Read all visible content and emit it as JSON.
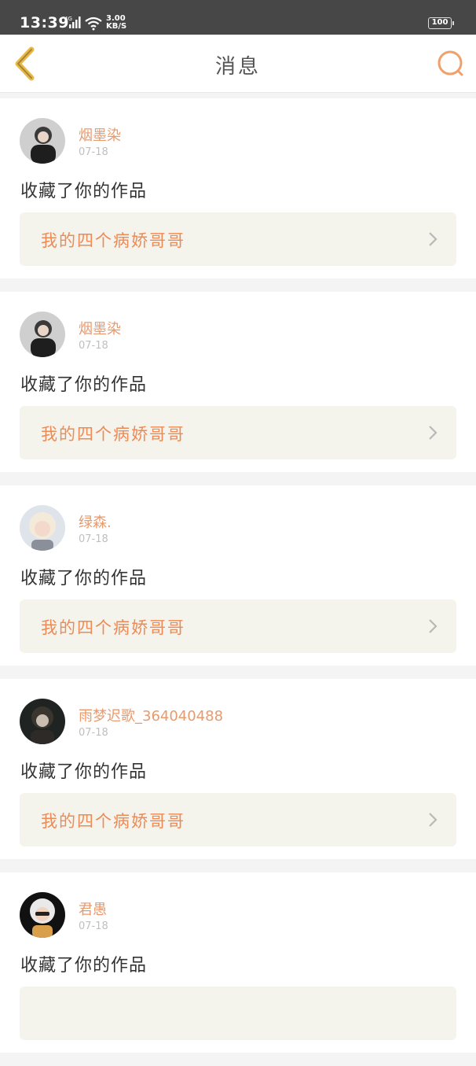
{
  "status_bar": {
    "time": "13:39",
    "network": "4G",
    "speed_value": "3.00",
    "speed_unit": "KB/S",
    "battery": "100"
  },
  "header": {
    "title": "消息",
    "back_icon": "chevron-left-icon",
    "search_icon": "search-icon"
  },
  "colors": {
    "accent": "#ed8a55",
    "username": "#e99a6d",
    "card_bg": "#ffffff",
    "work_bg": "#f5f4ec",
    "page_bg": "#f4f4f4",
    "status_bar": "#474747"
  },
  "notifications": [
    {
      "username": "烟墨染",
      "date": "07-18",
      "action": "收藏了你的作品",
      "work_title": "我的四个病娇哥哥"
    },
    {
      "username": "烟墨染",
      "date": "07-18",
      "action": "收藏了你的作品",
      "work_title": "我的四个病娇哥哥"
    },
    {
      "username": "绿森.",
      "date": "07-18",
      "action": "收藏了你的作品",
      "work_title": "我的四个病娇哥哥"
    },
    {
      "username": "雨梦迟歌_364040488",
      "date": "07-18",
      "action": "收藏了你的作品",
      "work_title": "我的四个病娇哥哥"
    },
    {
      "username": "君愚",
      "date": "07-18",
      "action": "收藏了你的作品",
      "work_title": ""
    }
  ]
}
